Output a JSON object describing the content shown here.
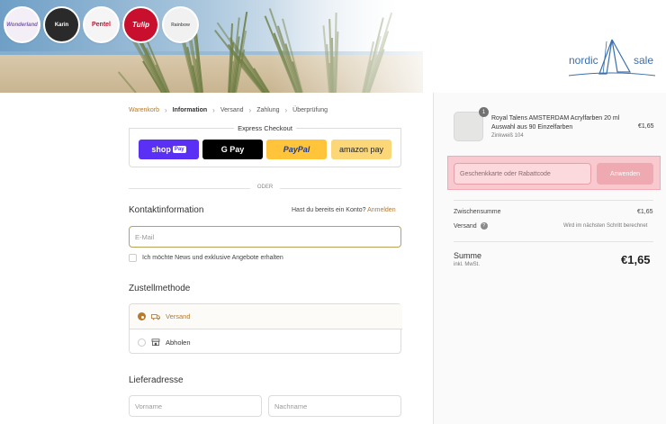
{
  "colors": {
    "accent": "#b57a2f",
    "highlight": "#f8c9cf",
    "shop_pay": "#5a31f4",
    "paypal": "#ffc439",
    "amazon": "#fcd777"
  },
  "header": {
    "brand_logos": [
      {
        "name": "Wonderland",
        "color": "#ffffff"
      },
      {
        "name": "Karin",
        "color": "#222222"
      },
      {
        "name": "Pentel",
        "color": "#c8102e"
      },
      {
        "name": "Tulip",
        "color": "#c8102e"
      },
      {
        "name": "Rainbow",
        "color": "#ffffff"
      }
    ],
    "store_logo_left": "nordic",
    "store_logo_right": "sale"
  },
  "breadcrumb": {
    "items": [
      "Warenkorb",
      "Information",
      "Versand",
      "Zahlung",
      "Überprüfung"
    ],
    "current_index": 1
  },
  "express_checkout": {
    "title": "Express Checkout",
    "shop_label": "shop",
    "shop_badge": "Pay",
    "gpay_label": "G Pay",
    "paypal_label": "PayPal",
    "amazon_label": "amazon pay"
  },
  "divider_or": "ODER",
  "contact": {
    "heading": "Kontaktinformation",
    "account_prompt": "Hast du bereits ein Konto?",
    "login_link": "Anmelden",
    "email_placeholder": "E-Mail",
    "newsletter_label": "Ich möchte News und exklusive Angebote erhalten",
    "newsletter_checked": false
  },
  "delivery": {
    "heading": "Zustellmethode",
    "options": [
      {
        "label": "Versand",
        "selected": true,
        "icon": "truck-icon"
      },
      {
        "label": "Abholen",
        "selected": false,
        "icon": "store-icon"
      }
    ]
  },
  "address": {
    "heading": "Lieferadresse",
    "first_name_placeholder": "Vorname",
    "last_name_placeholder": "Nachname"
  },
  "summary": {
    "product": {
      "quantity": "1",
      "name": "Royal Talens AMSTERDAM Acrylfarben 20 ml Auswahl aus 90 Einzelfarben",
      "variant": "Zinkweiß 104",
      "price": "€1,65"
    },
    "discount_placeholder": "Geschenkkarte oder Rabattcode",
    "apply_label": "Anwenden",
    "subtotal_label": "Zwischensumme",
    "subtotal_value": "€1,65",
    "shipping_label": "Versand",
    "shipping_value": "Wird im nächsten Schritt berechnet",
    "total_label": "Summe",
    "total_sub": "inkl. MwSt.",
    "total_value": "€1,65"
  }
}
